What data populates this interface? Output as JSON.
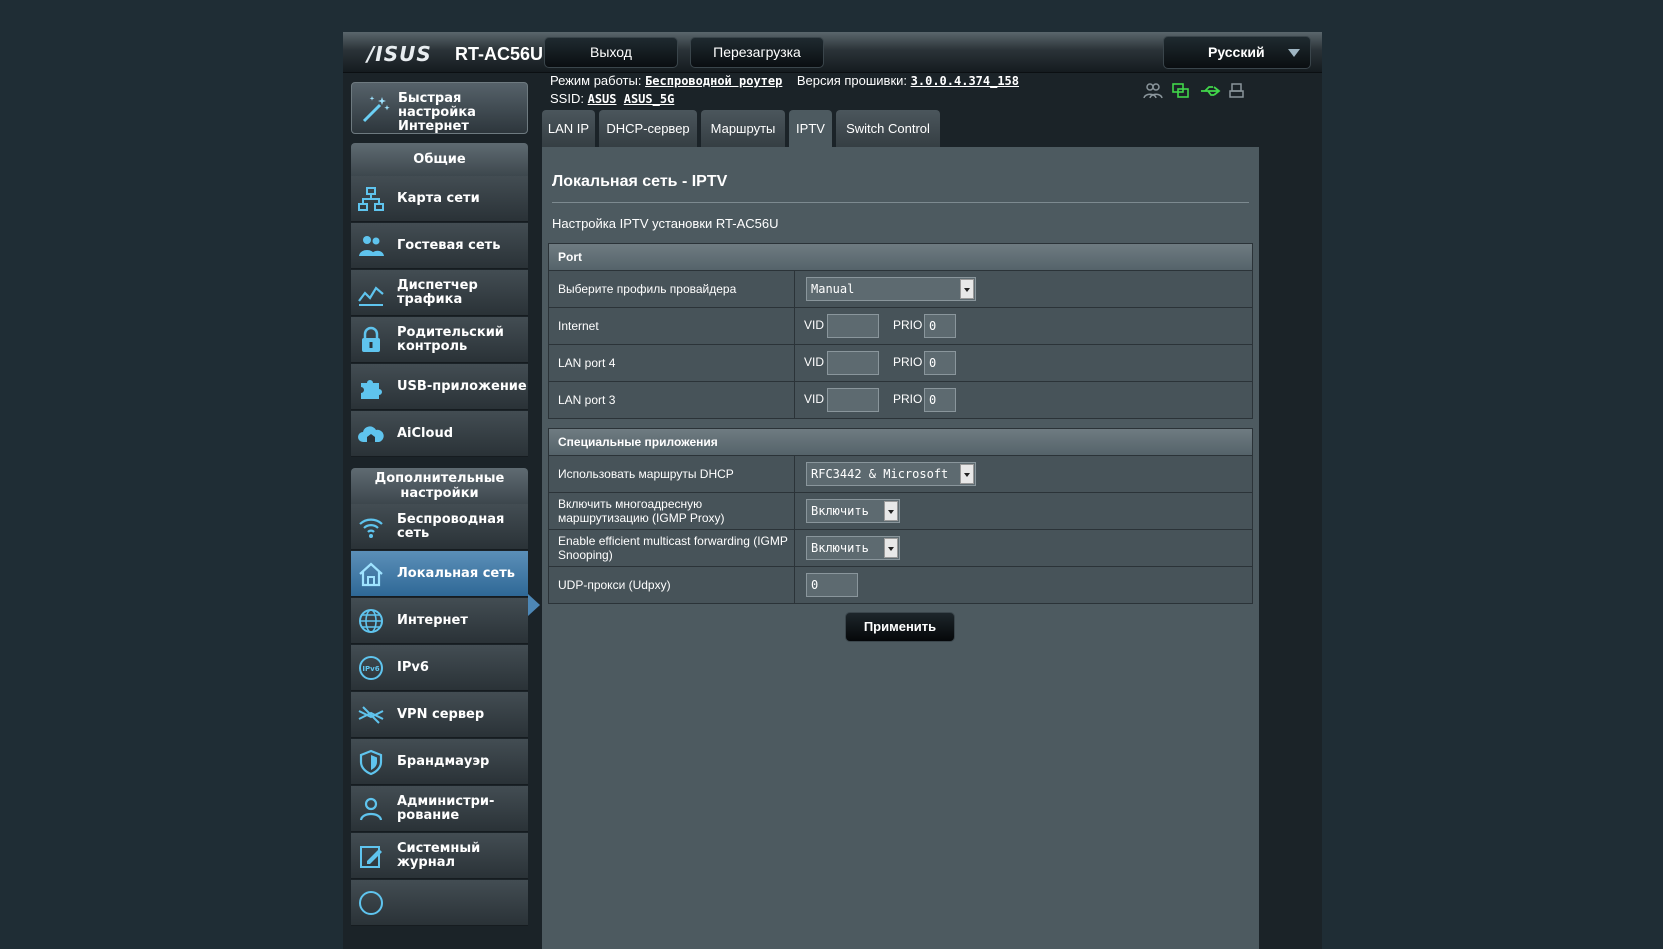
{
  "header": {
    "logo": "/ISUS",
    "model": "RT-AC56U",
    "logout_label": "Выход",
    "reboot_label": "Перезагрузка",
    "language": "Русский"
  },
  "info": {
    "mode_label": "Режим работы:",
    "mode_value": "Беспроводной роутер",
    "fw_label": "Версия прошивки:",
    "fw_value": "3.0.0.4.374_158",
    "ssid_label": "SSID:",
    "ssid_1": "ASUS",
    "ssid_2": "ASUS_5G"
  },
  "sidebar": {
    "quick_setup": [
      "Быстрая настройка",
      "Интернет"
    ],
    "general_header": "Общие",
    "general_items": [
      {
        "label": [
          "Карта сети"
        ],
        "icon": "network-map-icon"
      },
      {
        "label": [
          "Гостевая сеть"
        ],
        "icon": "guest-network-icon"
      },
      {
        "label": [
          "Диспетчер",
          "трафика"
        ],
        "icon": "traffic-manager-icon"
      },
      {
        "label": [
          "Родительский",
          "контроль"
        ],
        "icon": "parental-control-icon"
      },
      {
        "label": [
          "USB-приложение"
        ],
        "icon": "usb-app-icon"
      },
      {
        "label": [
          "AiCloud"
        ],
        "icon": "aicloud-icon"
      }
    ],
    "advanced_header": [
      "Дополнительные",
      "настройки"
    ],
    "advanced_items": [
      {
        "label": [
          "Беспроводная",
          "сеть"
        ],
        "icon": "wireless-icon"
      },
      {
        "label": [
          "Локальная сеть"
        ],
        "icon": "lan-icon",
        "active": true
      },
      {
        "label": [
          "Интернет"
        ],
        "icon": "internet-globe-icon"
      },
      {
        "label": [
          "IPv6"
        ],
        "icon": "ipv6-icon"
      },
      {
        "label": [
          "VPN сервер"
        ],
        "icon": "vpn-icon"
      },
      {
        "label": [
          "Брандмауэр"
        ],
        "icon": "firewall-icon"
      },
      {
        "label": [
          "Администри-",
          "рование"
        ],
        "icon": "admin-icon"
      },
      {
        "label": [
          "Системный",
          "журнал"
        ],
        "icon": "syslog-icon"
      }
    ]
  },
  "tabs": [
    {
      "label": "LAN IP"
    },
    {
      "label": "DHCP-сервер"
    },
    {
      "label": "Маршруты"
    },
    {
      "label": "IPTV",
      "active": true
    },
    {
      "label": "Switch Control"
    }
  ],
  "content": {
    "title": "Локальная сеть - IPTV",
    "subtitle": "Настройка IPTV установки RT-AC56U",
    "port_section": {
      "header": "Port",
      "profile_label": "Выберите профиль провайдера",
      "profile_value": "Manual",
      "vid_label": "VID",
      "prio_label": "PRIO",
      "rows": [
        {
          "label": "Internet",
          "vid": "",
          "prio": "0"
        },
        {
          "label": "LAN port 4",
          "vid": "",
          "prio": "0"
        },
        {
          "label": "LAN port 3",
          "vid": "",
          "prio": "0"
        }
      ]
    },
    "special_section": {
      "header": "Специальные приложения",
      "dhcp_routes_label": "Использовать маршруты DHCP",
      "dhcp_routes_value": "RFC3442 & Microsoft",
      "igmp_proxy_label": "Включить многоадресную маршрутизацию (IGMP Proxy)",
      "igmp_proxy_value": "Включить",
      "igmp_snooping_label": "Enable efficient multicast forwarding (IGMP Snooping)",
      "igmp_snooping_value": "Включить",
      "udpxy_label": "UDP-прокси (Udpxy)",
      "udpxy_value": "0"
    },
    "apply_label": "Применить"
  },
  "colors": {
    "background": "#1f2d35",
    "panel": "#4d5a60",
    "active_menu": "#3f7aa8",
    "accent_icon": "#5fc4ee",
    "status_green": "#41d64a"
  }
}
